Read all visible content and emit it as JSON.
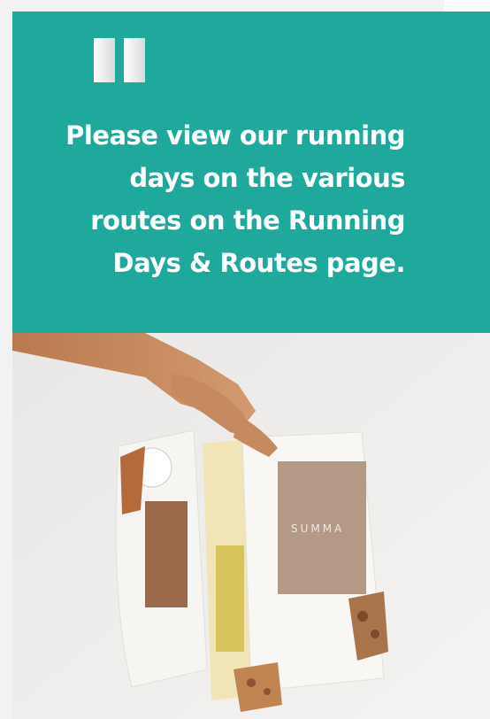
{
  "quote": {
    "text": "Please view our running days on the various routes on the Running Days & Routes page.",
    "icon": "quote-mark-icon"
  },
  "colors": {
    "card_background": "#1fa89c",
    "quote_text": "#ffffff",
    "page_background": "#f2f2f2"
  },
  "photo": {
    "icon": "product-photo",
    "logo_text": "SUMMA"
  }
}
